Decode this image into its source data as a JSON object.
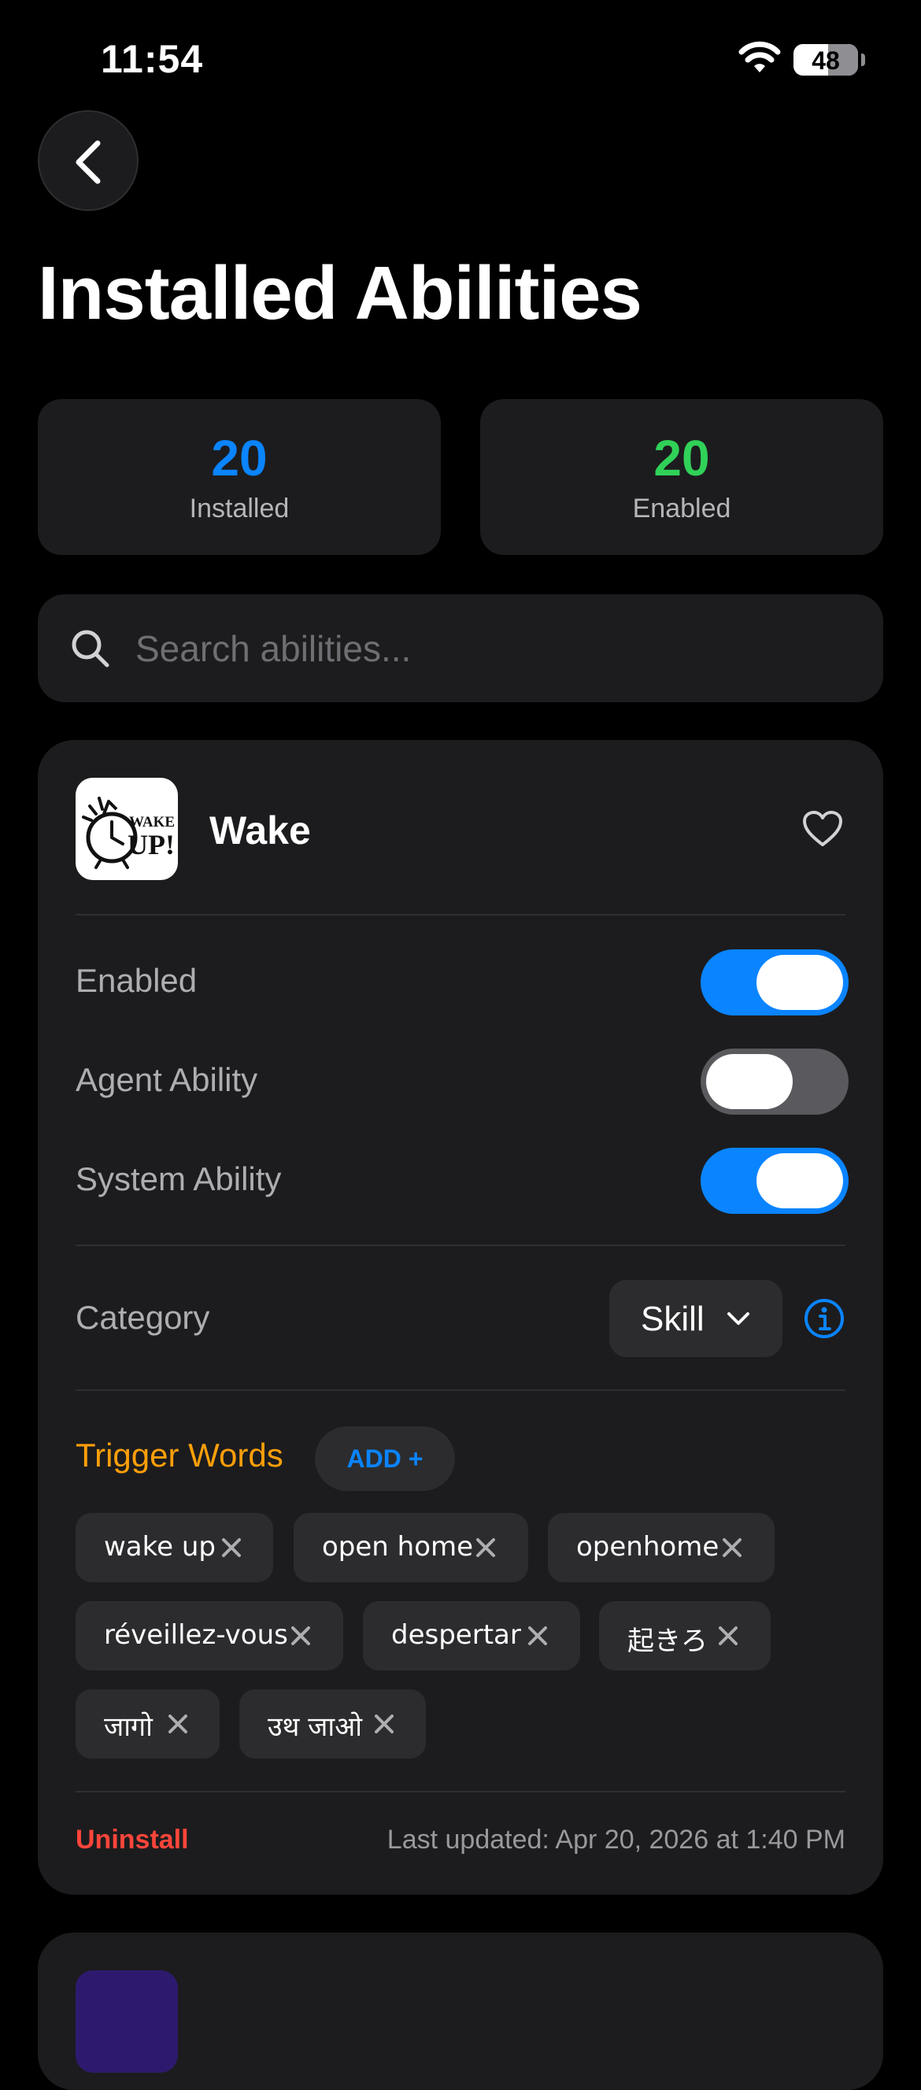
{
  "status_bar": {
    "time": "11:54",
    "battery": "48",
    "battery_level": 0.48
  },
  "header": {
    "title": "Installed Abilities"
  },
  "stats": {
    "installed": {
      "value": "20",
      "label": "Installed",
      "color": "#0a84ff"
    },
    "enabled": {
      "value": "20",
      "label": "Enabled",
      "color": "#30d158"
    }
  },
  "search": {
    "placeholder": "Search abilities..."
  },
  "ability": {
    "name": "Wake",
    "icon_text_line1": "WAKE",
    "icon_text_line2": "UP!",
    "toggles": [
      {
        "label": "Enabled",
        "on": true
      },
      {
        "label": "Agent Ability",
        "on": false
      },
      {
        "label": "System Ability",
        "on": true
      }
    ],
    "category": {
      "label": "Category",
      "value": "Skill"
    },
    "trigger_words": {
      "title": "Trigger Words",
      "add_label": "ADD +",
      "tags": [
        "wake up",
        "open home",
        "openhome",
        "réveillez-vous",
        "despertar",
        "起きろ",
        "जागो",
        "उथ जाओ"
      ]
    },
    "uninstall_label": "Uninstall",
    "last_updated": "Last updated: Apr 20, 2026 at 1:40 PM"
  },
  "colors": {
    "accent_blue": "#0a84ff",
    "accent_green": "#30d158",
    "accent_orange": "#ff9f0a",
    "destructive_red": "#ff453a"
  }
}
